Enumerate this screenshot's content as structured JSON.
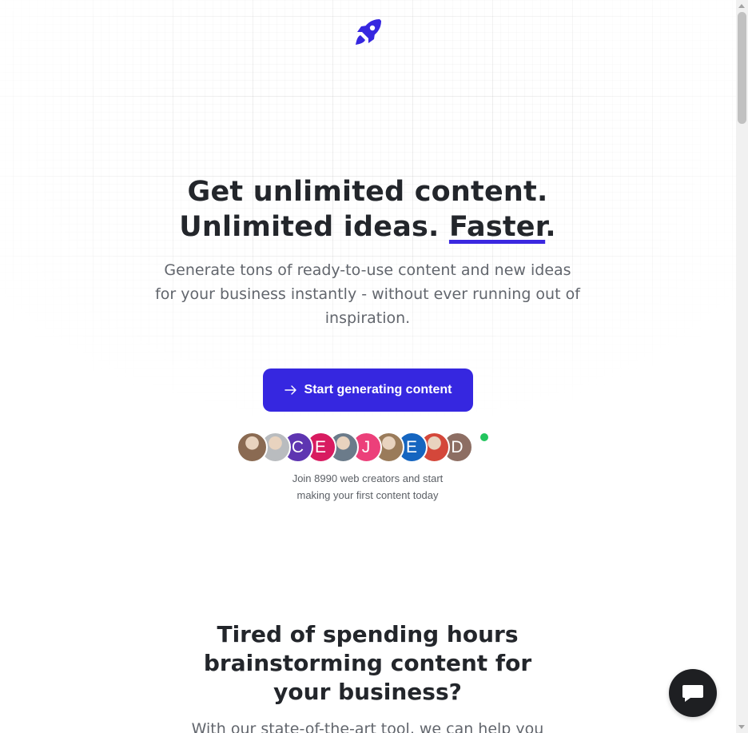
{
  "brand": {
    "logo_icon": "rocket-icon",
    "accent_color": "#3627e0"
  },
  "hero": {
    "title_line1": "Get unlimited content.",
    "title_line2_prefix": "Unlimited ideas. ",
    "title_highlight": "Faster",
    "title_suffix": ".",
    "subtitle": "Generate tons of ready-to-use content and new ideas for your business instantly - without ever running out of inspiration.",
    "cta_label": "Start generating content",
    "cta_icon": "arrow-right-icon"
  },
  "social_proof": {
    "avatars": [
      {
        "type": "photo",
        "color": "#8a6a52"
      },
      {
        "type": "photo",
        "color": "#b9bcbf"
      },
      {
        "type": "initial",
        "letter": "C",
        "color": "#5e35b1"
      },
      {
        "type": "initial",
        "letter": "E",
        "color": "#d81b60"
      },
      {
        "type": "photo",
        "color": "#6b7b8a"
      },
      {
        "type": "initial",
        "letter": "J",
        "color": "#ec407a"
      },
      {
        "type": "photo",
        "color": "#9a7b5a"
      },
      {
        "type": "initial",
        "letter": "E",
        "color": "#1565c0"
      },
      {
        "type": "photo",
        "color": "#d4473a"
      },
      {
        "type": "initial",
        "letter": "D",
        "color": "#8d6e63"
      }
    ],
    "status_color": "#22c55e",
    "join_text": "Join 8990 web creators and start making your first content today"
  },
  "section2": {
    "title": "Tired of spending hours brainstorming content for your business?",
    "text": "With our state-of-the-art tool, we can help you"
  },
  "chat_widget": {
    "icon": "chat-bubble-icon"
  }
}
